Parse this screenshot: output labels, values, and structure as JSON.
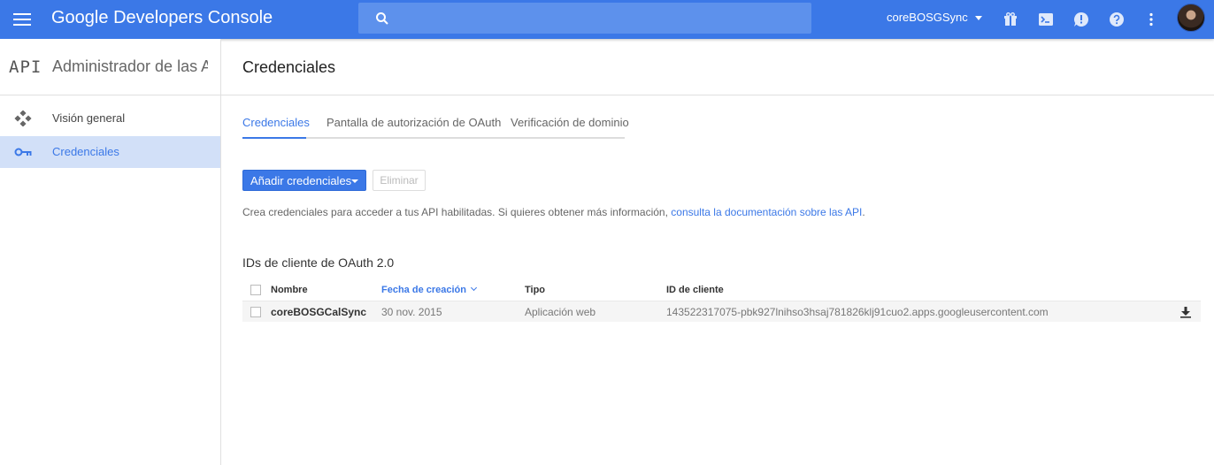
{
  "header": {
    "app_title": "Google Developers Console",
    "brand": "Google",
    "product": "Developers Console",
    "project_name": "coreBOSGSync",
    "icons": [
      "menu-icon",
      "search-icon",
      "gift-icon",
      "terminal-icon",
      "feedback-icon",
      "help-icon",
      "more-vert-icon",
      "avatar"
    ],
    "accent_color": "#3b78e7"
  },
  "sidebar": {
    "api_badge": "API",
    "title": "Administrador de las API",
    "items": [
      {
        "label": "Visión general",
        "icon": "overview-icon",
        "active": false
      },
      {
        "label": "Credenciales",
        "icon": "key-icon",
        "active": true
      }
    ]
  },
  "main": {
    "title": "Credenciales",
    "tabs": [
      {
        "label": "Credenciales",
        "active": true
      },
      {
        "label": "Pantalla de autorización de OAuth",
        "active": false
      },
      {
        "label": "Verificación de dominio",
        "active": false
      }
    ],
    "add_button_label": "Añadir credenciales",
    "delete_button_label": "Eliminar",
    "info_text": "Crea credenciales para acceder a tus API habilitadas. Si quieres obtener más información, ",
    "info_link": "consulta la documentación sobre las API",
    "info_suffix": ".",
    "oauth_section": {
      "title": "IDs de cliente de OAuth 2.0",
      "columns": [
        "Nombre",
        "Fecha de creación",
        "Tipo",
        "ID de cliente"
      ],
      "rows": [
        {
          "name": "coreBOSGCalSync",
          "created": "30 nov. 2015",
          "type": "Aplicación web",
          "client_id": "143522317075-pbk927lnihso3hsaj781826klj91cuo2.apps.googleusercontent.com"
        }
      ]
    }
  }
}
